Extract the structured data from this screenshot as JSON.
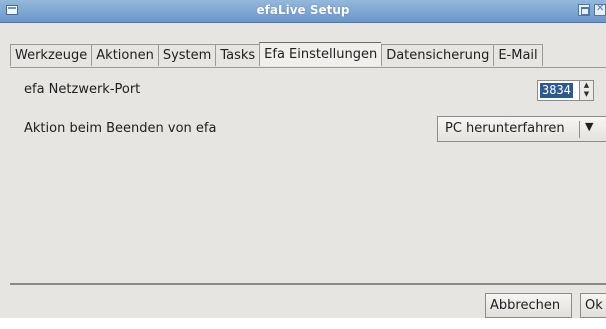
{
  "window": {
    "title": "efaLive Setup"
  },
  "tabs": [
    {
      "label": "Werkzeuge"
    },
    {
      "label": "Aktionen"
    },
    {
      "label": "System"
    },
    {
      "label": "Tasks"
    },
    {
      "label": "Efa Einstellungen",
      "active": true
    },
    {
      "label": "Datensicherung"
    },
    {
      "label": "E-Mail"
    }
  ],
  "settings": {
    "port_label": "efa Netzwerk-Port",
    "port_value": "3834",
    "exit_action_label": "Aktion beim Beenden von efa",
    "exit_action_value": "PC herunterfahren"
  },
  "footer": {
    "cancel_label": "Abbrechen",
    "ok_label": "Ok"
  },
  "colors": {
    "titlebar": "#6a97c8",
    "selection": "#2e5a8b",
    "window_bg": "#e6e5e2"
  }
}
